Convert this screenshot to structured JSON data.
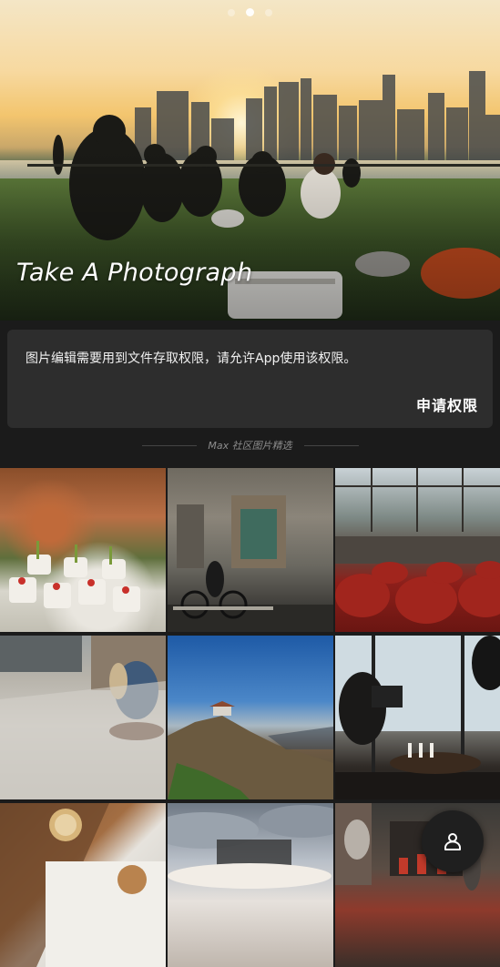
{
  "carousel": {
    "title": "Take A Photograph",
    "page_count": 3,
    "active_index": 1
  },
  "permission_card": {
    "message": "图片编辑需要用到文件存取权限，请允许App使用该权限。",
    "button_label": "申请权限"
  },
  "section": {
    "label": "Max 社区图片精选"
  },
  "gallery": {
    "tiles": [
      {
        "subject": "catering-food"
      },
      {
        "subject": "cyclist-building"
      },
      {
        "subject": "stadium-seats"
      },
      {
        "subject": "sidewalk-people"
      },
      {
        "subject": "mountain-lookout"
      },
      {
        "subject": "photographer-window"
      },
      {
        "subject": "coffee-table"
      },
      {
        "subject": "cloudy-sky"
      },
      {
        "subject": "shop-interior"
      }
    ]
  },
  "fab": {
    "icon": "person-icon"
  },
  "colors": {
    "background": "#1b1b1b",
    "card": "#2d2d2d",
    "divider_text": "#8c8c8c"
  }
}
